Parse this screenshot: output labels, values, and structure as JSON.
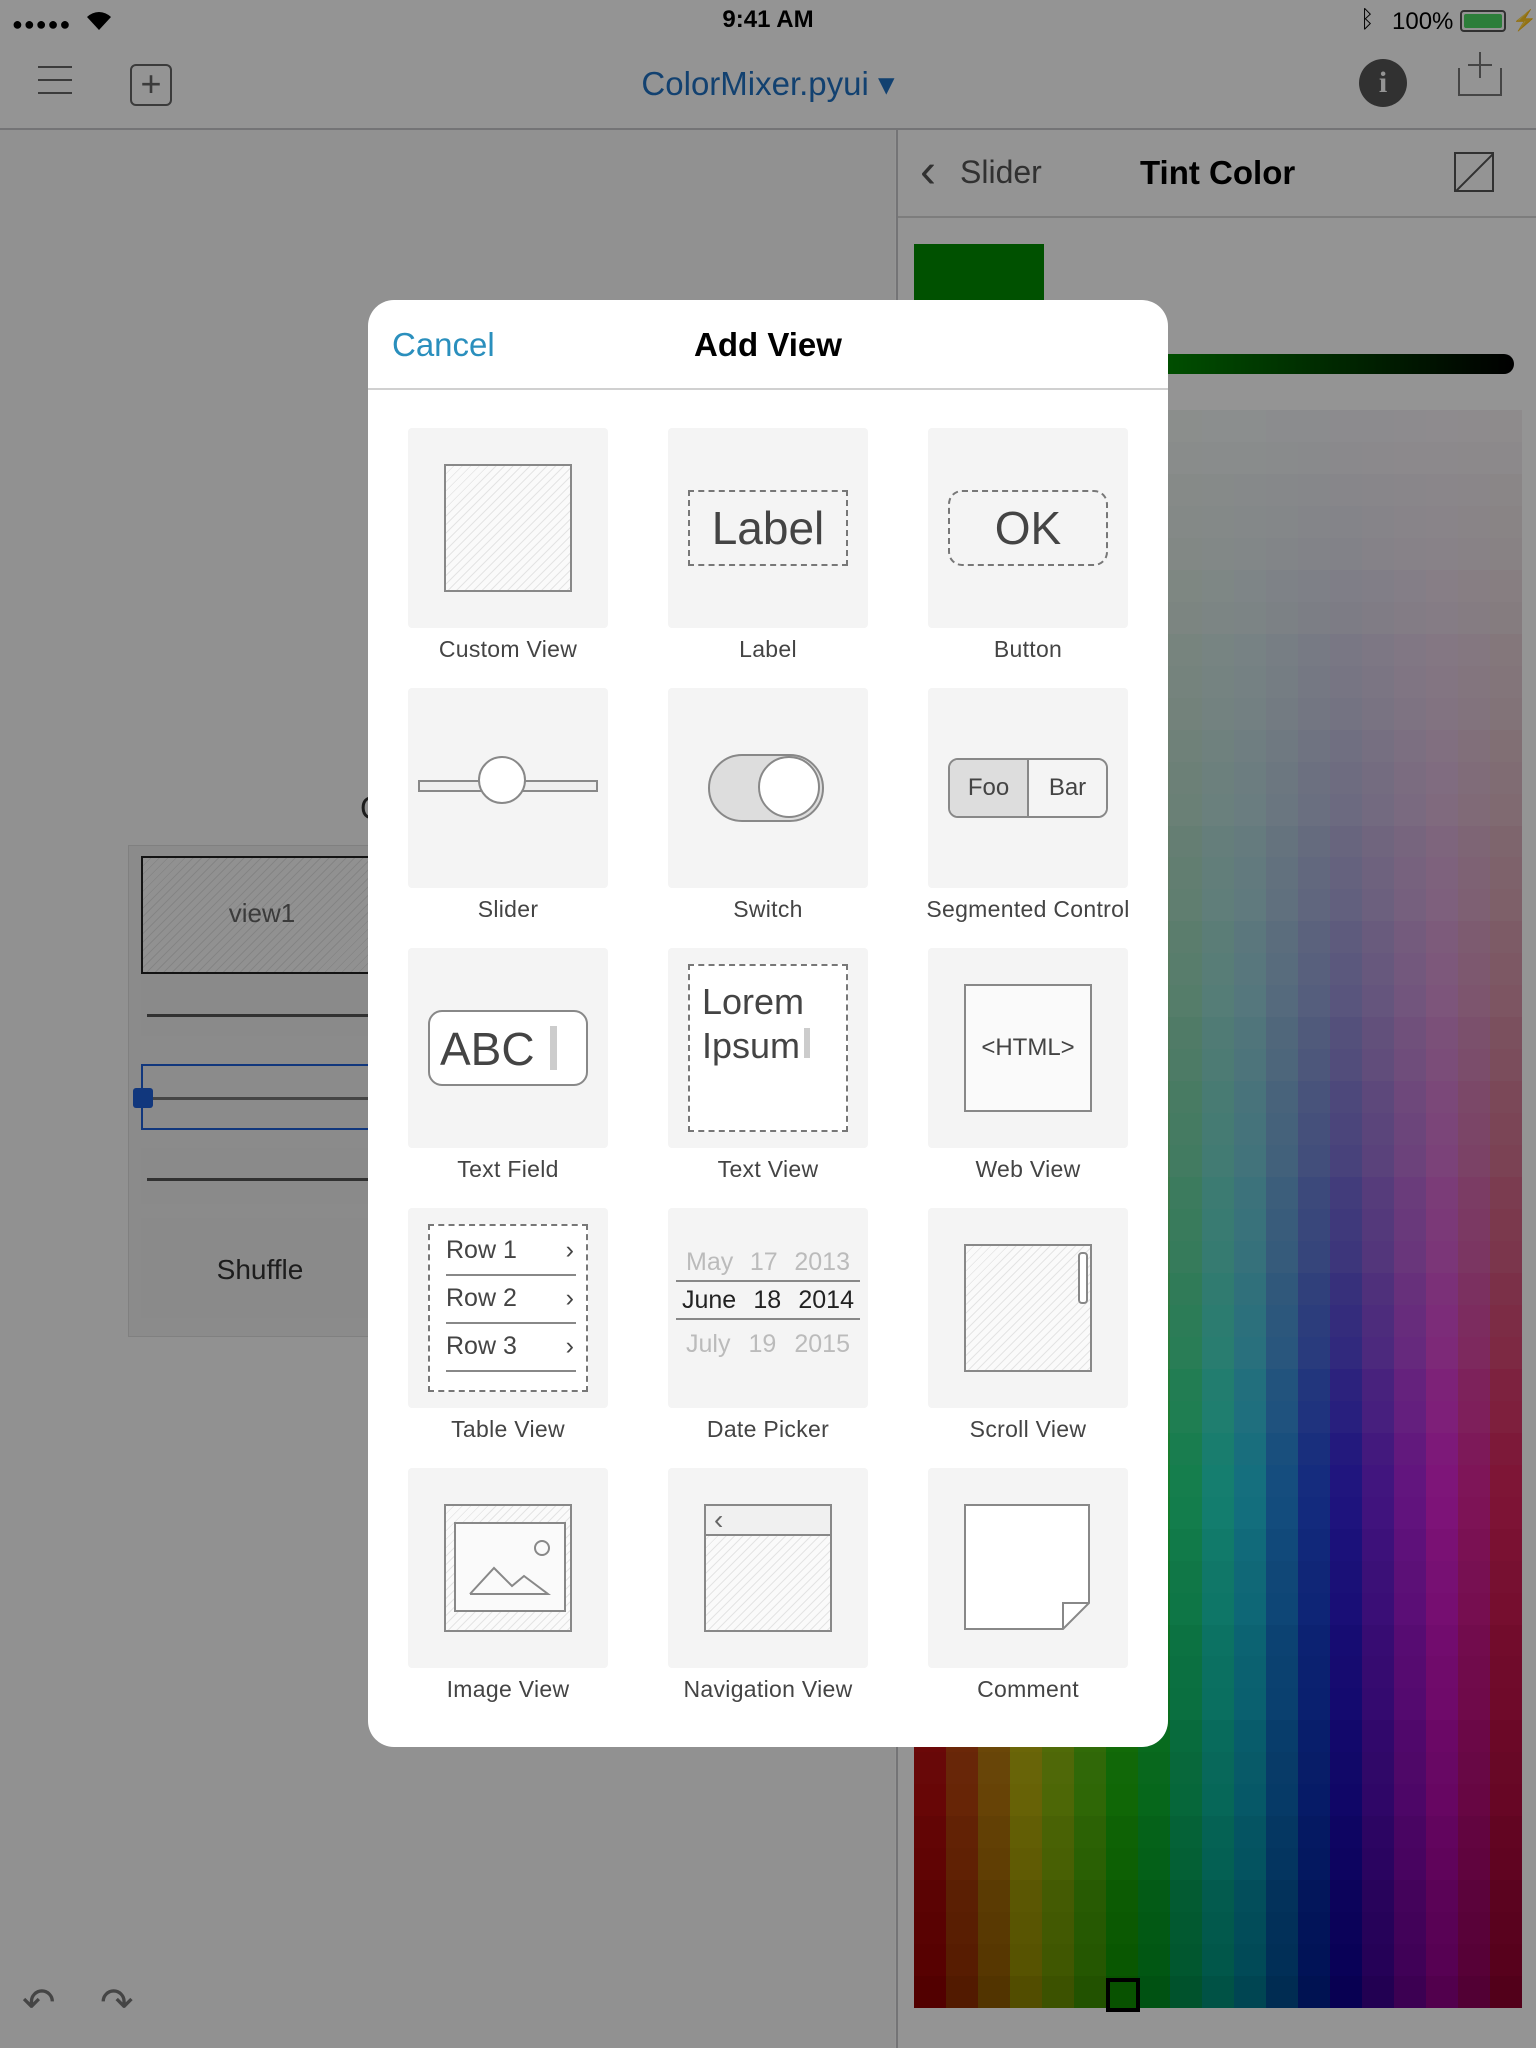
{
  "status_bar": {
    "time": "9:41 AM",
    "battery": "100%"
  },
  "toolbar": {
    "document_title": "ColorMixer.pyui ▾"
  },
  "editor": {
    "view_label": "view1",
    "button_label": "Shuffle",
    "partial_title": "C"
  },
  "inspector": {
    "back_label": "Slider",
    "title": "Tint Color",
    "swatch_color": "#008c00"
  },
  "modal": {
    "cancel_label": "Cancel",
    "title": "Add View",
    "items": [
      {
        "label": "Custom View",
        "icon": "custom-view-icon"
      },
      {
        "label": "Label",
        "icon": "label-icon",
        "preview": "Label"
      },
      {
        "label": "Button",
        "icon": "button-icon",
        "preview": "OK"
      },
      {
        "label": "Slider",
        "icon": "slider-icon"
      },
      {
        "label": "Switch",
        "icon": "switch-icon"
      },
      {
        "label": "Segmented Control",
        "icon": "segmented-control-icon",
        "segments": [
          "Foo",
          "Bar"
        ]
      },
      {
        "label": "Text Field",
        "icon": "text-field-icon",
        "preview": "ABC"
      },
      {
        "label": "Text View",
        "icon": "text-view-icon",
        "preview_lines": [
          "Lorem",
          "Ipsum"
        ]
      },
      {
        "label": "Web View",
        "icon": "web-view-icon",
        "preview": "<HTML>"
      },
      {
        "label": "Table View",
        "icon": "table-view-icon",
        "rows": [
          "Row 1",
          "Row 2",
          "Row 3"
        ]
      },
      {
        "label": "Date Picker",
        "icon": "date-picker-icon",
        "rows": [
          {
            "month": "May",
            "day": "17",
            "year": "2013"
          },
          {
            "month": "June",
            "day": "18",
            "year": "2014"
          },
          {
            "month": "July",
            "day": "19",
            "year": "2015"
          }
        ]
      },
      {
        "label": "Scroll View",
        "icon": "scroll-view-icon"
      },
      {
        "label": "Image View",
        "icon": "image-view-icon"
      },
      {
        "label": "Navigation View",
        "icon": "navigation-view-icon"
      },
      {
        "label": "Comment",
        "icon": "comment-icon"
      }
    ]
  },
  "colors": {
    "accent": "#2a8fbd",
    "title_blue": "#1f70c1",
    "selection": "#1e5fd8"
  }
}
